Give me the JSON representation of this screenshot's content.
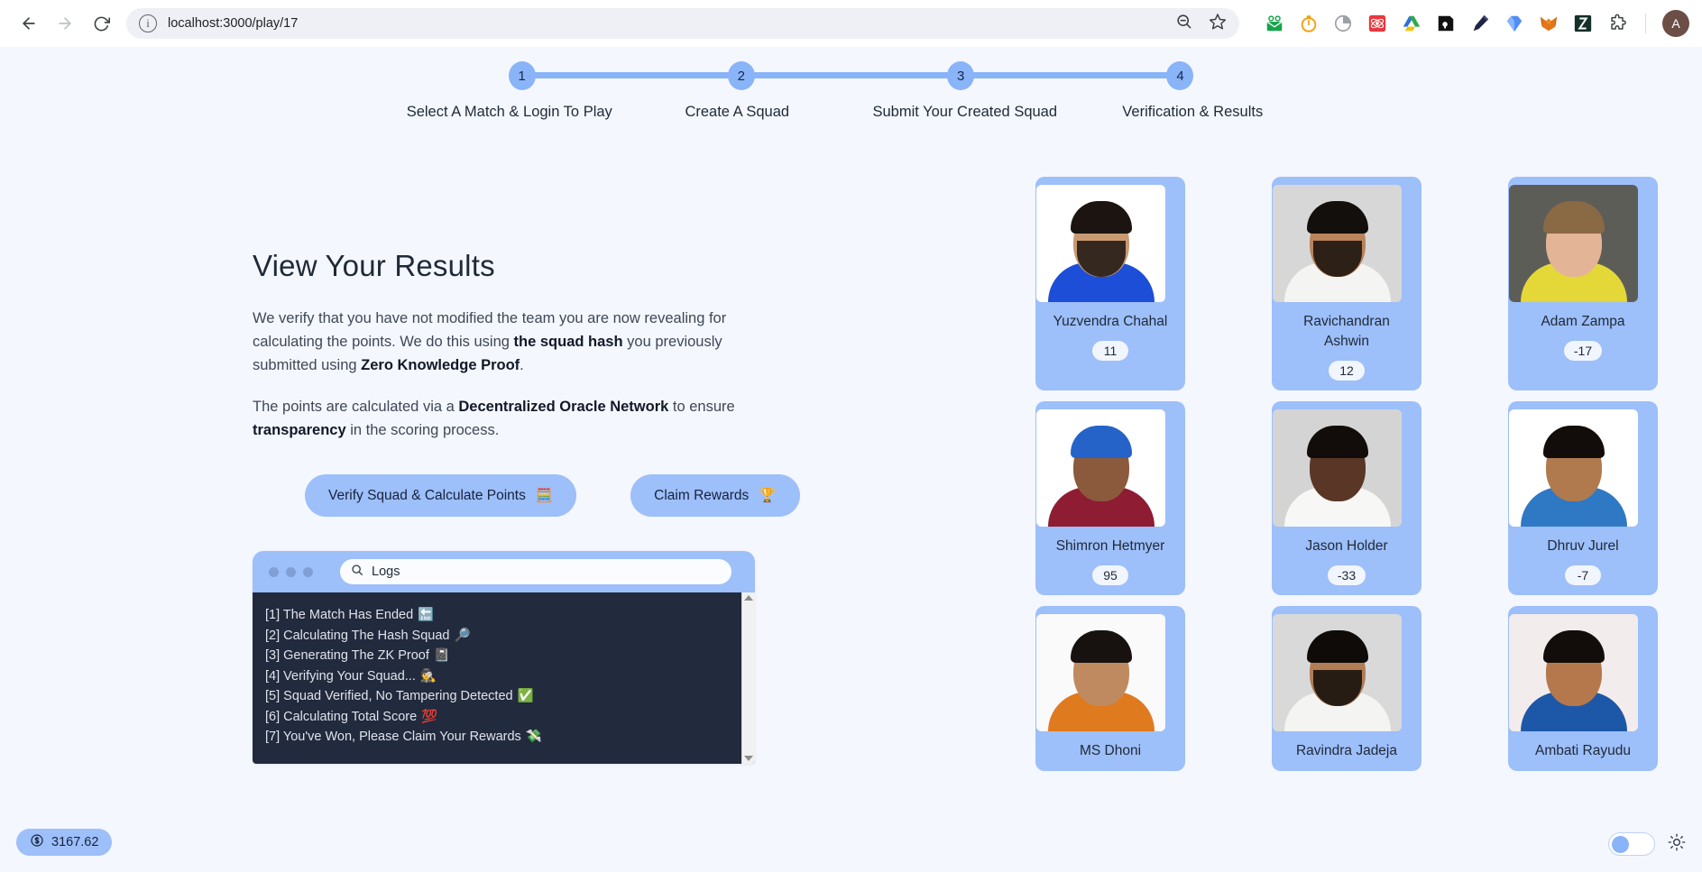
{
  "browser": {
    "url": "localhost:3000/play/17",
    "back_icon": "back-arrow-icon",
    "forward_icon": "forward-arrow-icon",
    "reload_icon": "reload-icon",
    "info_icon": "site-info-icon",
    "zoom_icon": "zoom-out-icon",
    "bookmark_icon": "star-icon",
    "profile_initial": "A",
    "extensions": [
      {
        "name": "ext-green-envelope",
        "label": ""
      },
      {
        "name": "ext-orange-timer",
        "label": ""
      },
      {
        "name": "ext-pie-clock",
        "label": ""
      },
      {
        "name": "ext-red-atom",
        "label": ""
      },
      {
        "name": "ext-google-drive",
        "label": ""
      },
      {
        "name": "ext-black-lock",
        "label": ""
      },
      {
        "name": "ext-dark-pen",
        "label": ""
      },
      {
        "name": "ext-blue-diamond",
        "label": ""
      },
      {
        "name": "ext-metamask-fox",
        "label": ""
      },
      {
        "name": "ext-green-play",
        "label": ""
      },
      {
        "name": "ext-puzzle-piece",
        "label": ""
      }
    ]
  },
  "stepper": {
    "steps": [
      {
        "number": "1",
        "label": "Select A Match & Login To Play"
      },
      {
        "number": "2",
        "label": "Create A Squad"
      },
      {
        "number": "3",
        "label": "Submit Your Created Squad"
      },
      {
        "number": "4",
        "label": "Verification & Results"
      }
    ]
  },
  "panel": {
    "title": "View Your Results",
    "paragraph1_a": "We verify that you have not modified the team you are now revealing for calculating the points. We do this using ",
    "paragraph1_b": "the squad hash",
    "paragraph1_c": " you previously submitted using ",
    "paragraph1_d": "Zero Knowledge Proof",
    "paragraph1_e": ".",
    "paragraph2_a": "The points are calculated via a ",
    "paragraph2_b": "Decentralized Oracle Network",
    "paragraph2_c": " to ensure ",
    "paragraph2_d": "transparency",
    "paragraph2_e": " in the scoring process.",
    "verify_button": "Verify Squad & Calculate Points",
    "verify_button_icon": "🧮",
    "claim_button": "Claim Rewards",
    "claim_button_icon": "🏆"
  },
  "terminal": {
    "search_placeholder": "Logs",
    "search_value": "Logs",
    "search_icon": "search-icon",
    "lines": [
      {
        "text": "[1] The Match Has Ended",
        "emoji": "🔚"
      },
      {
        "text": "[2] Calculating The Hash Squad",
        "emoji": "🔎"
      },
      {
        "text": "[3] Generating The ZK Proof",
        "emoji": "📓"
      },
      {
        "text": "[4] Verifying Your Squad...",
        "emoji": "🕵️"
      },
      {
        "text": "[5] Squad Verified, No Tampering Detected",
        "emoji": "✅"
      },
      {
        "text": "[6] Calculating Total Score",
        "emoji": "💯"
      },
      {
        "text": "[7] You've Won, Please Claim Your Rewards",
        "emoji": "💸"
      }
    ]
  },
  "players": [
    {
      "name": "Yuzvendra Chahal",
      "score": "11",
      "skin": "#c99a72",
      "hair": "#1b1410",
      "shirt": "#1d4ed8",
      "bg": "#ffffff",
      "beard": true
    },
    {
      "name": "Ravichandran Ashwin",
      "score": "12",
      "skin": "#b9835b",
      "hair": "#130f0c",
      "shirt": "#f4f4f2",
      "bg": "#d7d7d7",
      "beard": true
    },
    {
      "name": "Adam Zampa",
      "score": "-17",
      "skin": "#e3b495",
      "hair": "#8a6a45",
      "shirt": "#e4d838",
      "bg": "#5d5d58",
      "beard": false
    },
    {
      "name": "Shimron Hetmyer",
      "score": "95",
      "skin": "#8b5a3c",
      "hair": "#2563c9",
      "shirt": "#8e1c32",
      "bg": "#ffffff",
      "beard": false
    },
    {
      "name": "Jason Holder",
      "score": "-33",
      "skin": "#5a3626",
      "hair": "#120d0a",
      "shirt": "#f7f7f5",
      "bg": "#d4d4d4",
      "beard": false
    },
    {
      "name": "Dhruv Jurel",
      "score": "-7",
      "skin": "#b07a4e",
      "hair": "#120d0a",
      "shirt": "#2f79c4",
      "bg": "#ffffff",
      "beard": false
    },
    {
      "name": "MS Dhoni",
      "score": "",
      "skin": "#c08a60",
      "hair": "#171210",
      "shirt": "#e07a1f",
      "bg": "#fafafa",
      "beard": false
    },
    {
      "name": "Ravindra Jadeja",
      "score": "",
      "skin": "#b07d55",
      "hair": "#0f0b09",
      "shirt": "#f4f4f2",
      "bg": "#d9d9d9",
      "beard": true
    },
    {
      "name": "Ambati Rayudu",
      "score": "",
      "skin": "#b5784d",
      "hair": "#120d0a",
      "shirt": "#1d58a8",
      "bg": "#f3ecec",
      "beard": false
    }
  ],
  "footer": {
    "balance_value": "3167.62",
    "balance_icon": "dollar-coin-icon",
    "theme_icon": "sun-icon",
    "theme_toggle_state": "off"
  },
  "colors": {
    "accent": "#9dbffa",
    "page_bg": "#f4f7fe",
    "terminal_bg": "#222a3d",
    "text": "#1f2937"
  }
}
